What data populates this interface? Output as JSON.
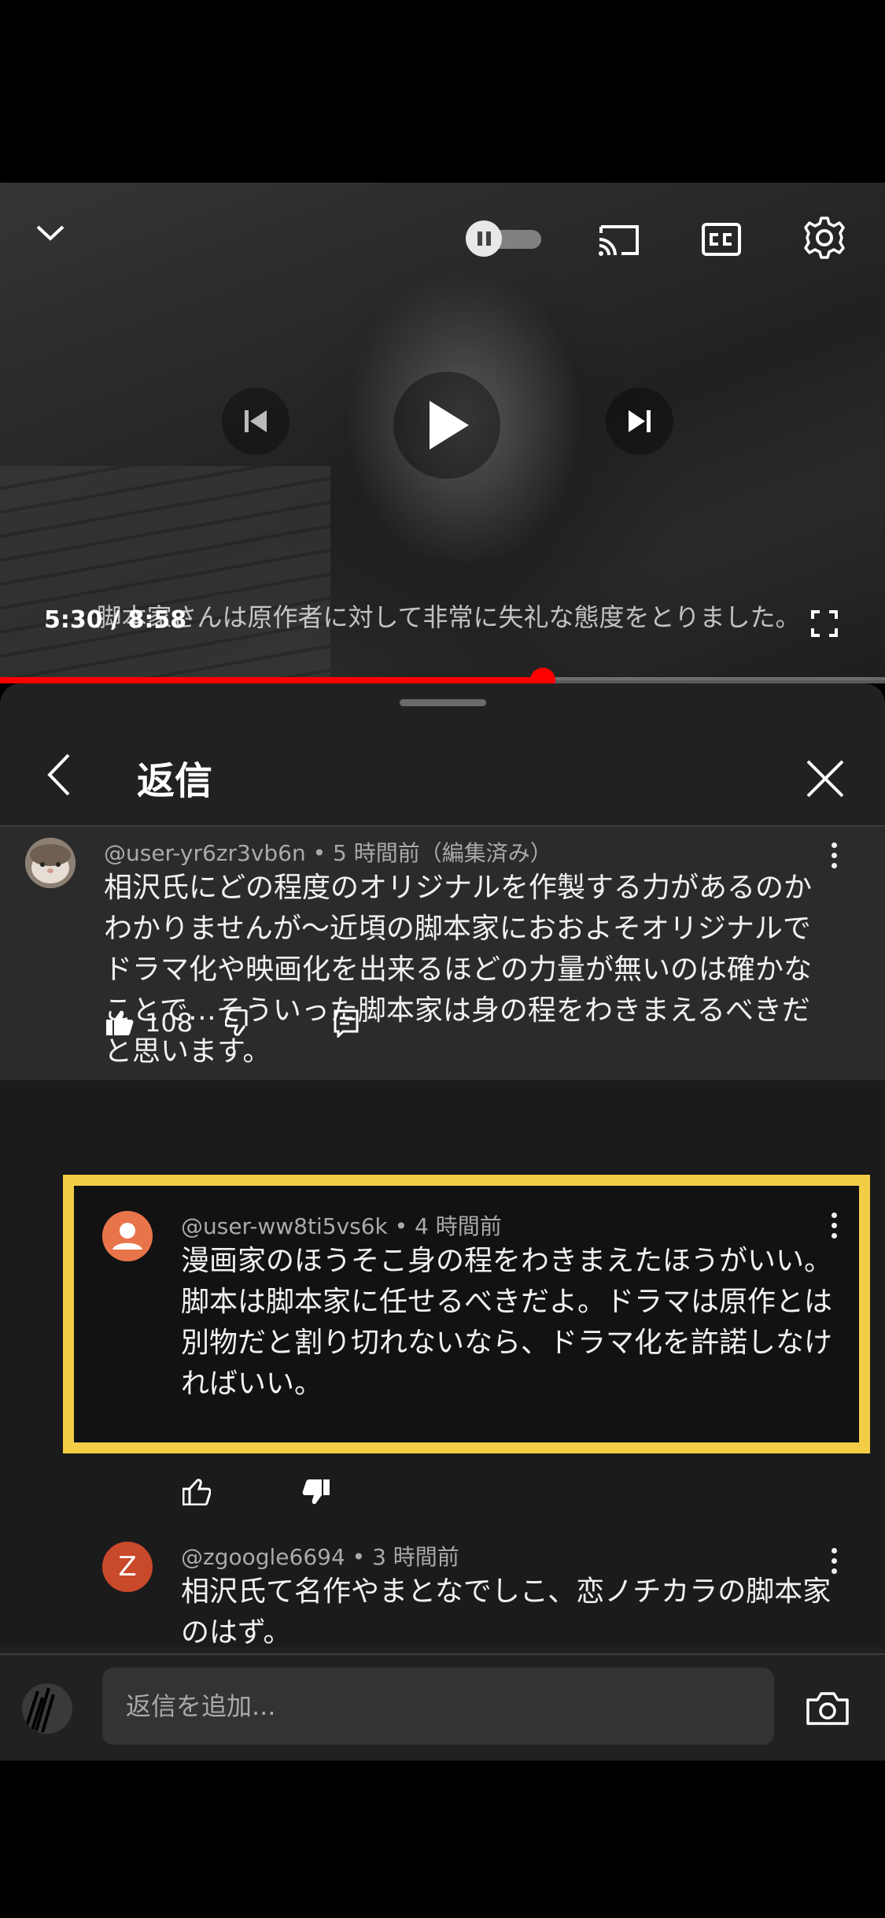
{
  "player": {
    "elapsed": "5:30",
    "duration": "8:58",
    "time_display": "5:30 / 8:58",
    "progress_fraction": 0.613,
    "subtitle": "脚本家さんは原作者に対して非常に失礼な態度をとりました。",
    "autoplay_on": true
  },
  "replies_panel": {
    "title": "返信",
    "parent_comment": {
      "handle": "@user-yr6zr3vb6n",
      "meta": "@user-yr6zr3vb6n • 5 時間前（編集済み）",
      "lines": [
        "相沢氏にどの程度のオリジナルを作製する力があるのか",
        "わかりませんが〜近頃の脚本家におおよそオリジナルで",
        "ドラマ化や映画化を出来るほどの力量が無いのは確かな",
        "ことで…そういった脚本家は身の程をわきまえるべきだ",
        "と思います。"
      ],
      "likes": "108"
    },
    "replies": [
      {
        "meta": "@user-ww8ti5vs6k • 4 時間前",
        "avatar_color": "#e8744a",
        "lines": [
          "漫画家のほうそこ身の程をわきまえたほうがいい。",
          "脚本は脚本家に任せるべきだよ。ドラマは原作とは",
          "別物だと割り切れないなら、ドラマ化を許諾しなけ",
          "ればいい。"
        ],
        "highlighted": true
      },
      {
        "meta": "@zgoogle6694 • 3 時間前",
        "avatar_letter": "Z",
        "avatar_color": "#c9492b",
        "lines": [
          "相沢氏て名作やまとなでしこ、恋ノチカラの脚本家",
          "のはず。"
        ]
      }
    ],
    "composer_placeholder": "返信を追加..."
  },
  "colors": {
    "accent": "#ff0000",
    "highlight_border": "#f3cd45"
  },
  "icons": [
    "chevron-down-icon",
    "pause-icon",
    "cast-icon",
    "cc-icon",
    "gear-icon",
    "previous-icon",
    "play-icon",
    "next-icon",
    "fullscreen-icon",
    "back-icon",
    "close-icon",
    "more-vert-icon",
    "thumb-up-icon",
    "thumb-down-icon",
    "reply-icon",
    "camera-icon"
  ]
}
